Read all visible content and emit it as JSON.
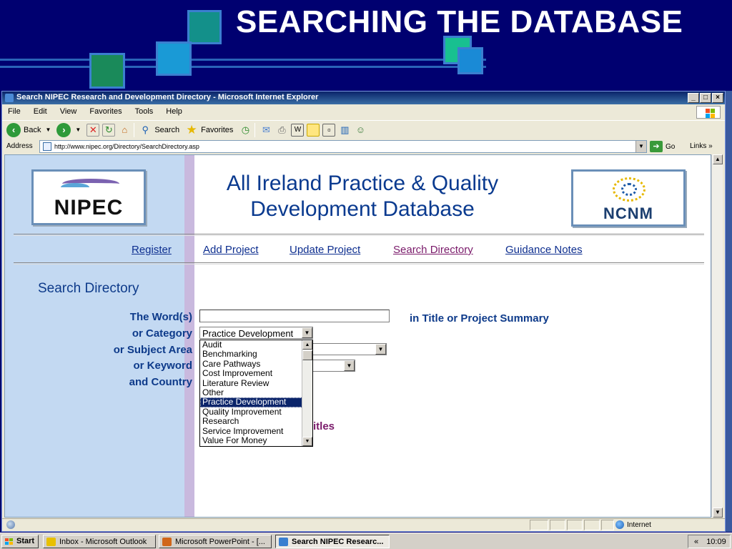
{
  "slide": {
    "title": "SEARCHING THE DATABASE"
  },
  "browser": {
    "window_title": "Search NIPEC Research and Development Directory - Microsoft Internet Explorer",
    "menu": [
      "File",
      "Edit",
      "View",
      "Favorites",
      "Tools",
      "Help"
    ],
    "toolbar": {
      "back": "Back",
      "search": "Search",
      "favorites": "Favorites"
    },
    "address_label": "Address",
    "url": "http://www.nipec.org/Directory/SearchDirectory.asp",
    "go_label": "Go",
    "links_label": "Links",
    "status_zone": "Internet"
  },
  "page": {
    "logo_left": "NIPEC",
    "logo_right": "NCNM",
    "db_title_line1": "All Ireland Practice & Quality",
    "db_title_line2": "Development Database",
    "nav": [
      {
        "label": "Register"
      },
      {
        "label": "Add Project"
      },
      {
        "label": "Update Project"
      },
      {
        "label": "Search Directory"
      },
      {
        "label": "Guidance Notes"
      }
    ],
    "section_title": "Search Directory",
    "form": {
      "words_label": "The Word(s)",
      "words_value": "",
      "words_suffix": "in Title or Project Summary",
      "category_label": "or Category",
      "category_selected": "Practice Development",
      "subject_label": "or Subject Area",
      "keyword_label": "or Keyword",
      "country_label": "and Country",
      "category_options": [
        "Audit",
        "Benchmarking",
        "Care Pathways",
        "Cost Improvement",
        "Literature Review",
        "Other",
        "Practice Development",
        "Quality Improvement",
        "Research",
        "Service Improvement",
        "Value For Money"
      ],
      "partial_text": "itles"
    }
  },
  "taskbar": {
    "start": "Start",
    "tasks": [
      {
        "label": "Inbox - Microsoft Outlook"
      },
      {
        "label": "Microsoft PowerPoint - [..."
      },
      {
        "label": "Search NIPEC Researc..."
      }
    ],
    "time": "10:09"
  },
  "colors": {
    "slide_bg": "#000070",
    "page_left_column": "#c3d9f2",
    "heading_blue": "#0d3a8a",
    "visited_link": "#7a1a6a",
    "selection": "#0a246a"
  }
}
